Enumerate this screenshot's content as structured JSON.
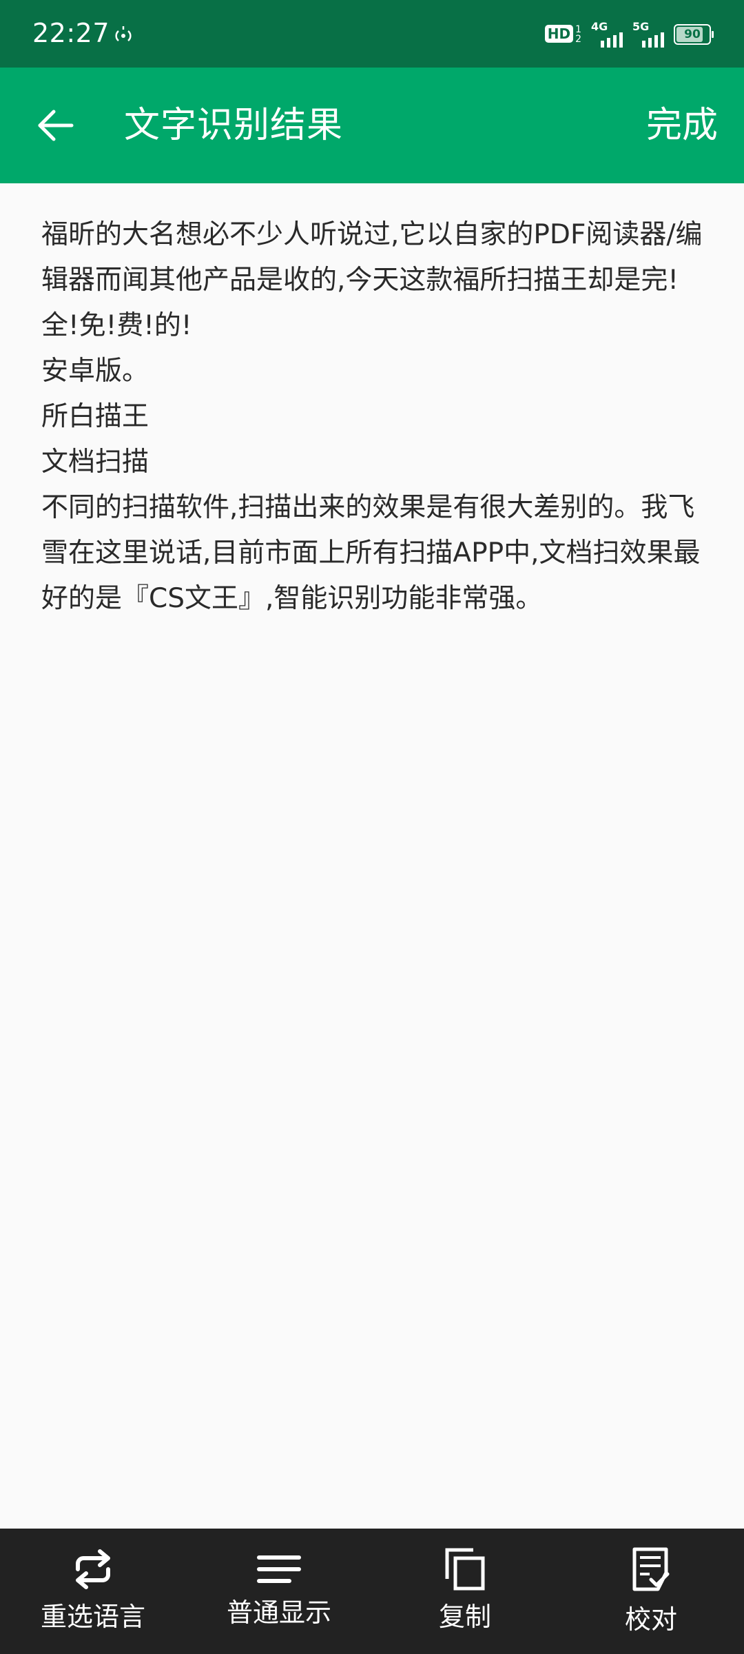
{
  "status_bar": {
    "time": "22:27",
    "hd_label": "HD",
    "hd_sub_top": "1",
    "hd_sub_bottom": "2",
    "network_1": "4G",
    "network_2": "5G",
    "battery": "90",
    "battery_level_percent": 90
  },
  "app_bar": {
    "title": "文字识别结果",
    "done_label": "完成"
  },
  "content": {
    "lines": [
      "福昕的大名想必不少人听说过,它以自家的PDF阅读器/编辑器而闻其他产品是收的,今天这款福所扫描王却是完!全!免!费!的!",
      "安卓版。",
      "所白描王",
      "文档扫描",
      "不同的扫描软件,扫描出来的效果是有很大差别的。我飞雪在这里说话,目前市面上所有扫描APP中,文档扫效果最好的是『CS文王』,智能识别功能非常强。"
    ]
  },
  "bottom_bar": {
    "items": [
      {
        "label": "重选语言",
        "icon": "repeat-icon"
      },
      {
        "label": "普通显示",
        "icon": "lines-icon"
      },
      {
        "label": "复制",
        "icon": "copy-icon"
      },
      {
        "label": "校对",
        "icon": "proofread-icon"
      }
    ]
  }
}
